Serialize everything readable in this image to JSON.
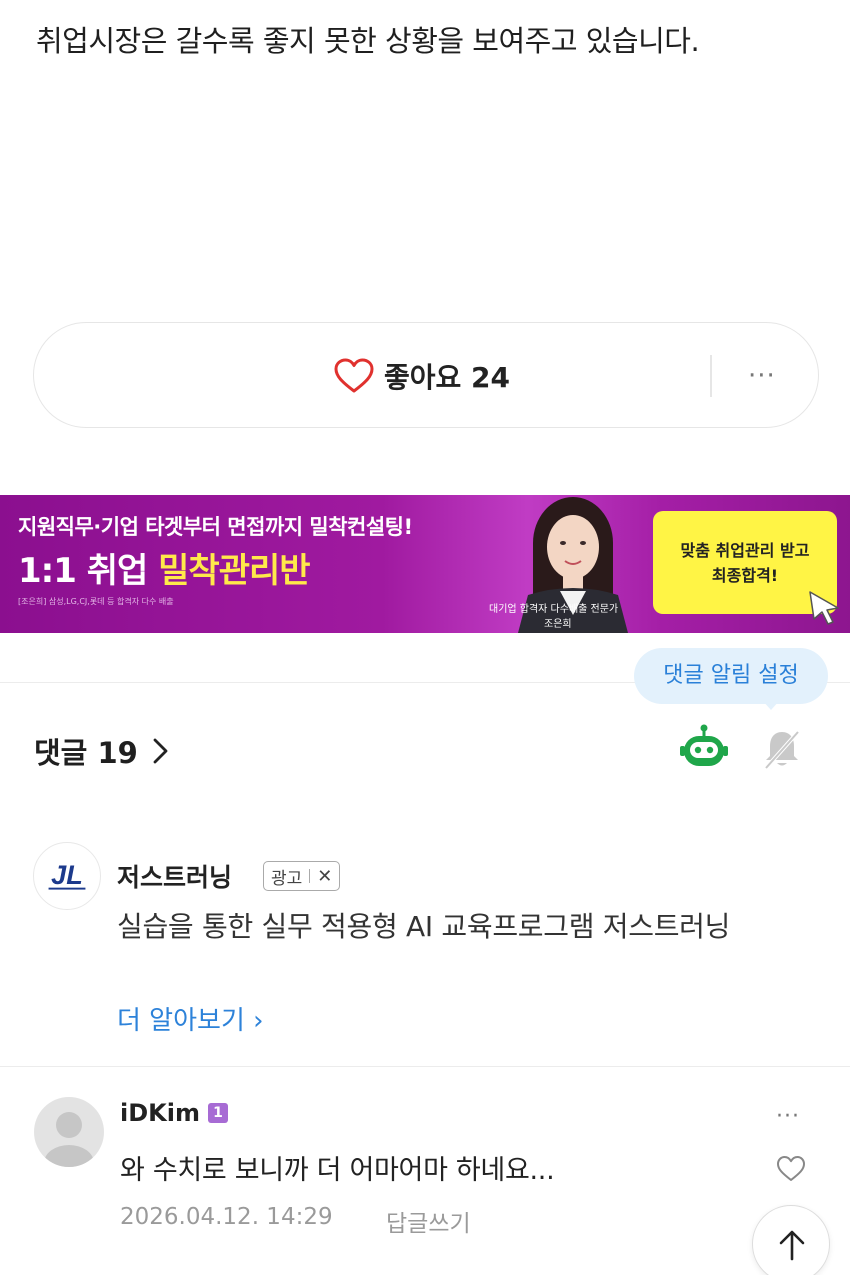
{
  "article": {
    "last_line": "취업시장은 갈수록 좋지 못한 상황을 보여주고 있습니다."
  },
  "like_bar": {
    "label": "좋아요 24",
    "more": "···"
  },
  "banner": {
    "headline": "지원직무·기업 타겟부터 면접까지 밀착컨설팅!",
    "main_prefix": "1:1 취업 ",
    "main_highlight": "밀착관리반",
    "fine_print": "[조은희] 삼성,LG,CJ,롯데 등 합격자 다수 배출",
    "person_caption": "대기업 합격자 다수배출 전문가",
    "person_name": "조은희",
    "cta_line1": "맞춤 취업관리 받고",
    "cta_line2": "최종합격!",
    "bg_color": "#a01aa0",
    "highlight_color": "#ffe94a",
    "cta_color": "#fff445"
  },
  "notification_tooltip": "댓글 알림 설정",
  "comments": {
    "header": "댓글 19",
    "ad": {
      "name": "저스트러닝",
      "badge": "광고",
      "close": "✕",
      "text": "실습을 통한 실무 적용형 AI 교육프로그램 저스트러닝",
      "link": "더 알아보기 ›"
    },
    "items": [
      {
        "author": "iDKim",
        "level": "1",
        "text": "와 수치로 보니까 더 어마어마 하네요...",
        "date": "2026.04.12. 14:29",
        "reply": "답글쓰기",
        "more": "···"
      }
    ]
  },
  "colors": {
    "accent_blue": "#2d82d9",
    "like_red": "#e0312e",
    "robot_green": "#1fa64a"
  }
}
